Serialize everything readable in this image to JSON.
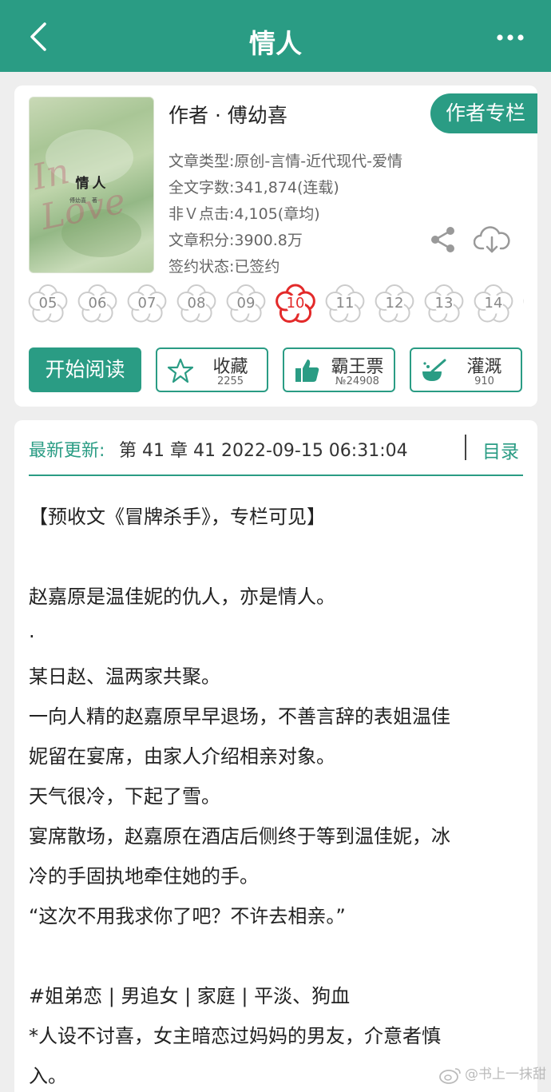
{
  "nav": {
    "title": "情人",
    "back_icon": "chevron-left-icon",
    "more_icon": "more-dots-icon"
  },
  "book": {
    "cover": {
      "title": "情人",
      "subtitle": "傅幼喜　著",
      "script": "In Love"
    },
    "author_line": "作者 · 傅幼喜",
    "author_column_button": "作者专栏",
    "meta": [
      "文章类型:原创-言情-近代现代-爱情",
      "全文字数:341,874(连载)",
      "非Ｖ点击:4,105(章均)",
      "文章积分:3900.8万",
      "签约状态:已签约"
    ],
    "share_icon": "share-icon",
    "download_icon": "cloud-download-icon"
  },
  "ratings": {
    "items": [
      "05",
      "06",
      "07",
      "08",
      "09",
      "10",
      "11",
      "12",
      "13",
      "14"
    ],
    "selected": "10",
    "colors": {
      "normal": "#cccccc",
      "selected": "#e32a2a"
    }
  },
  "actions": {
    "read": "开始阅读",
    "favorite": {
      "label": "收藏",
      "count": "2255",
      "icon": "star-icon"
    },
    "ticket": {
      "label": "霸王票",
      "count": "№24908",
      "icon": "thumbs-up-icon"
    },
    "water": {
      "label": "灌溉",
      "count": "910",
      "icon": "watering-icon"
    }
  },
  "update": {
    "label": "最新更新:",
    "text": "第 41 章 41 2022-09-15 06:31:04",
    "toc": "目录"
  },
  "synopsis": [
    "【预收文《冒牌杀手》，专栏可见】",
    "赵嘉原是温佳妮的仇人，亦是情人。",
    "·",
    "某日赵、温两家共聚。",
    "一向人精的赵嘉原早早退场，不善言辞的表姐温佳",
    "妮留在宴席，由家人介绍相亲对象。",
    "天气很冷，下起了雪。",
    "宴席散场，赵嘉原在酒店后侧终于等到温佳妮，冰",
    "冷的手固执地牵住她的手。",
    "“这次不用我求你了吧？不许去相亲。”",
    "#姐弟恋 | 男追女 | 家庭 | 平淡、狗血",
    "*人设不讨喜，女主暗恋过妈妈的男友，介意者慎",
    "入。"
  ],
  "watermark": "@书上一抹甜",
  "colors": {
    "brand": "#2a9c84",
    "background": "#eeeeee"
  }
}
